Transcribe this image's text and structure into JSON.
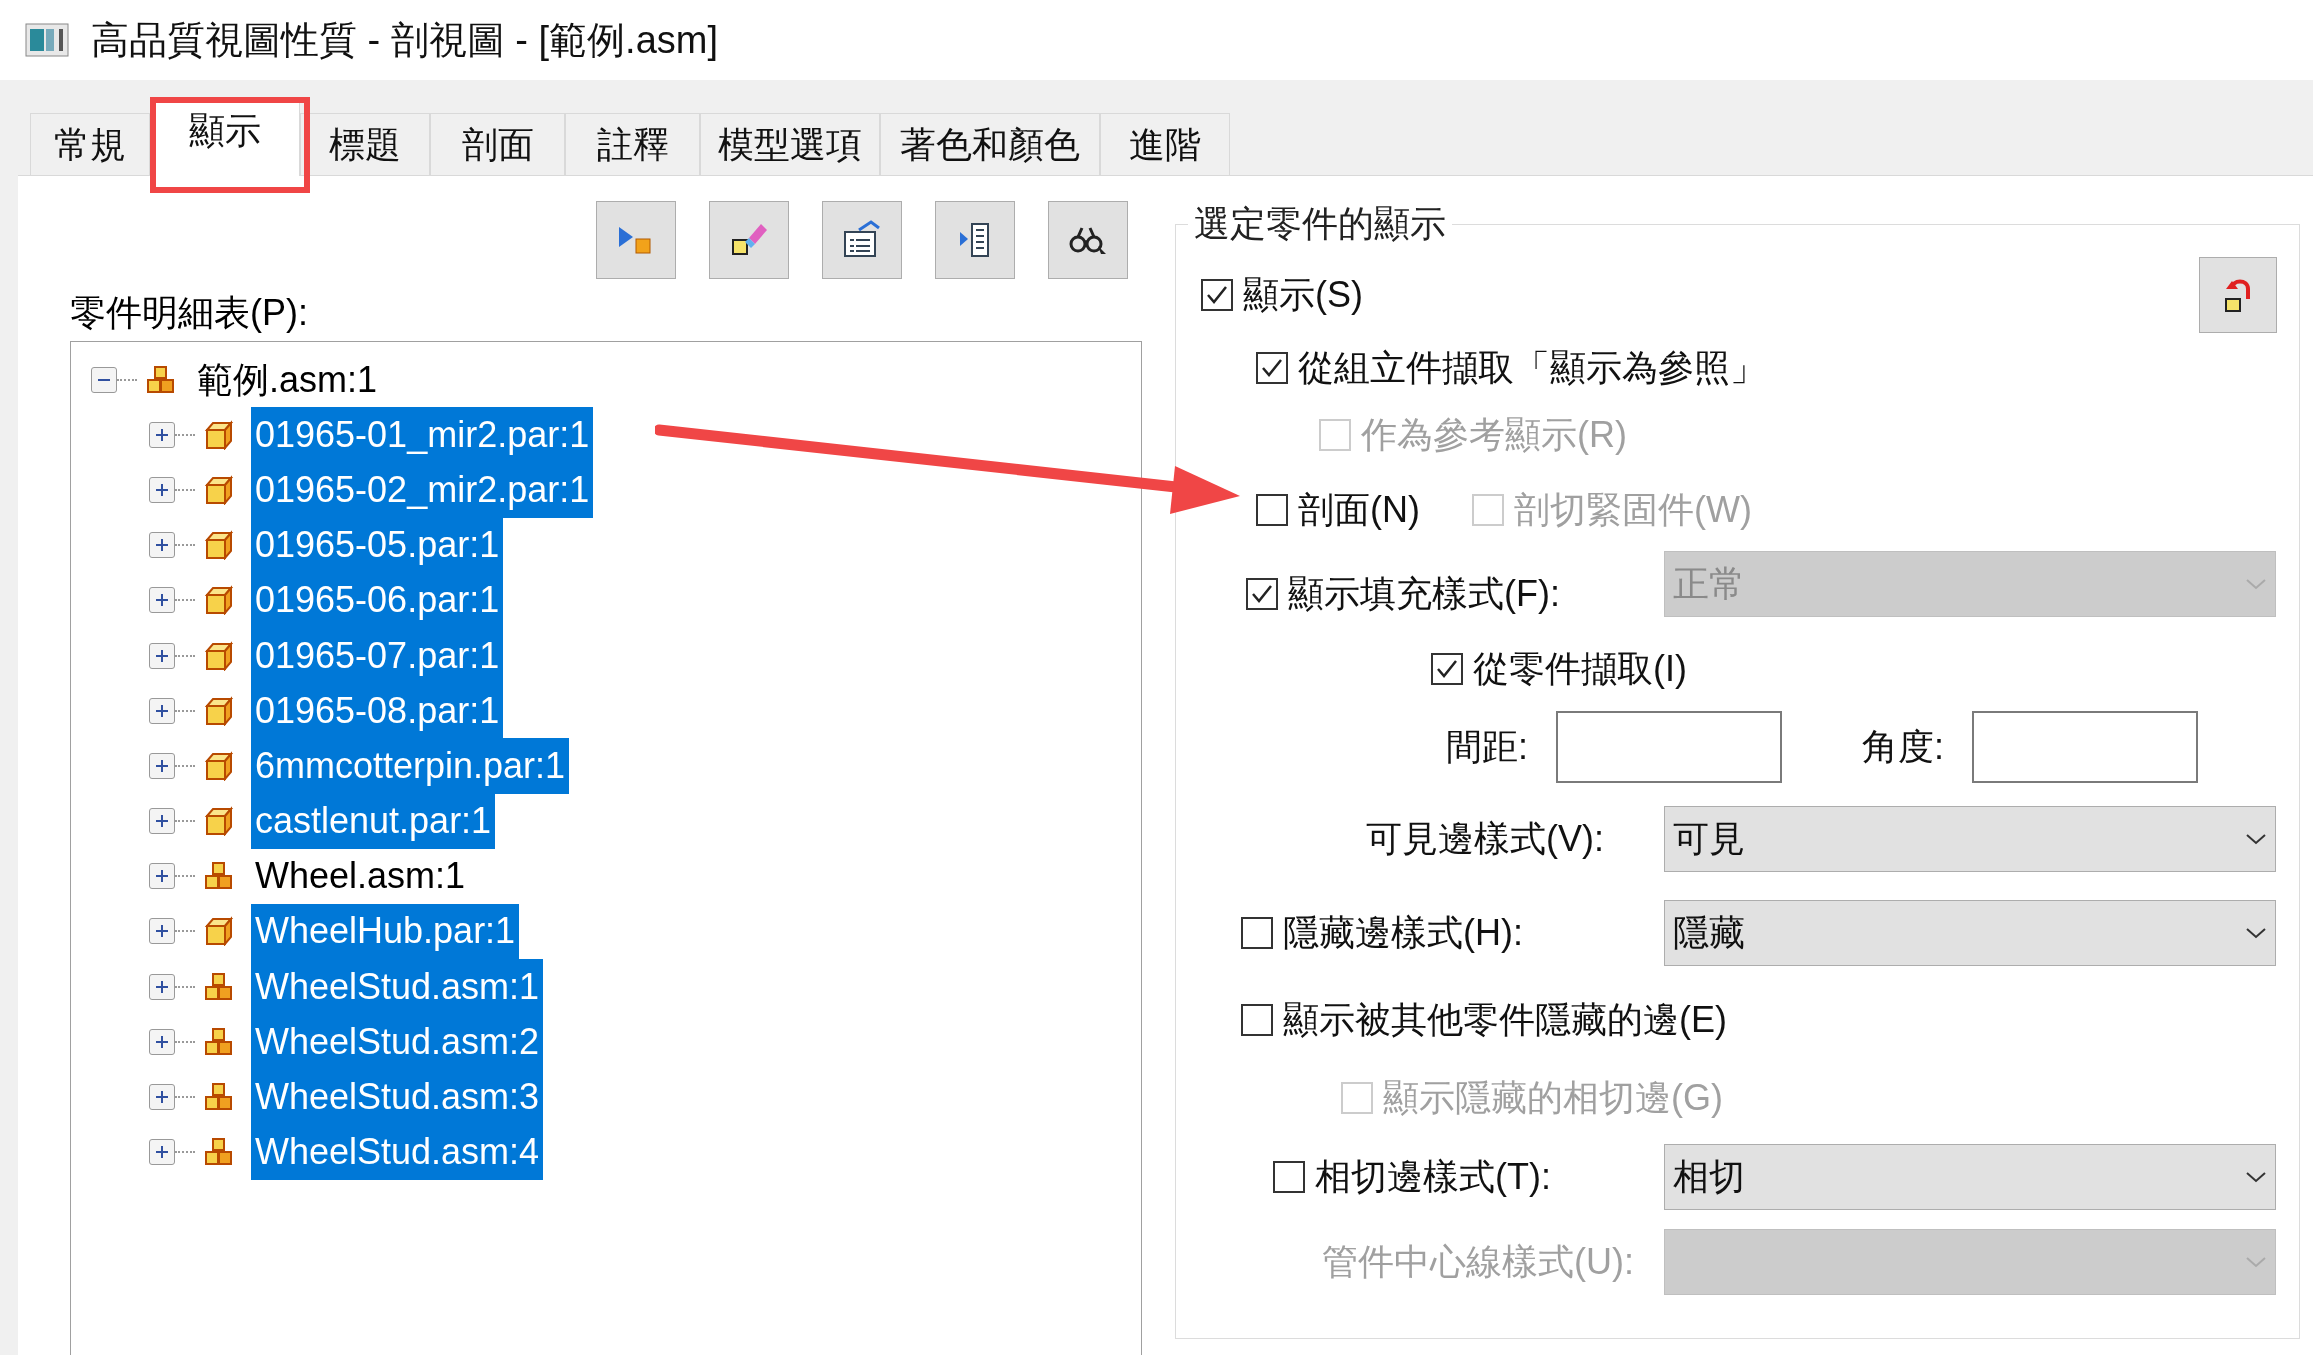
{
  "window": {
    "title": "高品質視圖性質 - 剖視圖 - [範例.asm]"
  },
  "tabs": [
    {
      "label": "常規",
      "selected": false
    },
    {
      "label": "顯示",
      "selected": true
    },
    {
      "label": "標題",
      "selected": false
    },
    {
      "label": "剖面",
      "selected": false
    },
    {
      "label": "註釋",
      "selected": false
    },
    {
      "label": "模型選項",
      "selected": false
    },
    {
      "label": "著色和顏色",
      "selected": false
    },
    {
      "label": "進階",
      "selected": false
    }
  ],
  "parts_list": {
    "label": "零件明細表(P):",
    "tree": [
      {
        "label": "範例.asm:1",
        "kind": "assembly",
        "expanded": true,
        "selected": false,
        "children": [
          {
            "label": "01965-01_mir2.par:1",
            "kind": "part",
            "expanded": false,
            "selected": true
          },
          {
            "label": "01965-02_mir2.par:1",
            "kind": "part",
            "expanded": false,
            "selected": true
          },
          {
            "label": "01965-05.par:1",
            "kind": "part",
            "expanded": false,
            "selected": true
          },
          {
            "label": "01965-06.par:1",
            "kind": "part",
            "expanded": false,
            "selected": true
          },
          {
            "label": "01965-07.par:1",
            "kind": "part",
            "expanded": false,
            "selected": true
          },
          {
            "label": "01965-08.par:1",
            "kind": "part",
            "expanded": false,
            "selected": true
          },
          {
            "label": "6mmcotterpin.par:1",
            "kind": "part",
            "expanded": false,
            "selected": true
          },
          {
            "label": "castlenut.par:1",
            "kind": "part",
            "expanded": false,
            "selected": true
          },
          {
            "label": "Wheel.asm:1",
            "kind": "assembly",
            "expanded": false,
            "selected": false
          },
          {
            "label": "WheelHub.par:1",
            "kind": "part",
            "expanded": false,
            "selected": true
          },
          {
            "label": "WheelStud.asm:1",
            "kind": "assembly",
            "expanded": false,
            "selected": true
          },
          {
            "label": "WheelStud.asm:2",
            "kind": "assembly",
            "expanded": false,
            "selected": true
          },
          {
            "label": "WheelStud.asm:3",
            "kind": "assembly",
            "expanded": false,
            "selected": true
          },
          {
            "label": "WheelStud.asm:4",
            "kind": "assembly",
            "expanded": false,
            "selected": true
          }
        ]
      }
    ]
  },
  "display_group": {
    "title": "選定零件的顯示",
    "rows": [
      {
        "kind": "checkbox",
        "label": "顯示(S)",
        "checked": true,
        "disabled": false
      },
      {
        "kind": "checkbox",
        "label": "從組立件擷取「顯示為參照」",
        "checked": true,
        "disabled": false
      },
      {
        "kind": "checkbox",
        "label": "作為參考顯示(R)",
        "checked": false,
        "disabled": true
      },
      {
        "kind": "checkbox_pair",
        "items": [
          {
            "label": "剖面(N)",
            "checked": false,
            "disabled": false
          },
          {
            "label": "剖切緊固件(W)",
            "checked": false,
            "disabled": true
          }
        ]
      },
      {
        "kind": "checkbox_select",
        "label": "顯示填充樣式(F):",
        "checked": true,
        "disabled": false,
        "select": {
          "value": "正常",
          "disabled": true
        }
      },
      {
        "kind": "checkbox",
        "label": "從零件擷取(I)",
        "checked": true,
        "disabled": false
      },
      {
        "kind": "fields",
        "fields": [
          {
            "label": "間距:"
          },
          {
            "label": "角度:"
          }
        ]
      },
      {
        "kind": "label_select",
        "label": "可見邊樣式(V):",
        "disabled": false,
        "select": {
          "value": "可見",
          "disabled": false
        }
      },
      {
        "kind": "checkbox_select",
        "label": "隱藏邊樣式(H):",
        "checked": false,
        "disabled": false,
        "select": {
          "value": "隱藏",
          "disabled": false
        }
      },
      {
        "kind": "checkbox",
        "label": "顯示被其他零件隱藏的邊(E)",
        "checked": false,
        "disabled": false
      },
      {
        "kind": "checkbox",
        "label": "顯示隱藏的相切邊(G)",
        "checked": false,
        "disabled": true
      },
      {
        "kind": "checkbox_select",
        "label": "相切邊樣式(T):",
        "checked": false,
        "disabled": false,
        "select": {
          "value": "相切",
          "disabled": false
        }
      },
      {
        "kind": "label_select",
        "label": "管件中心線樣式(U):",
        "disabled": true,
        "select": {
          "disabled": true
        }
      }
    ]
  }
}
